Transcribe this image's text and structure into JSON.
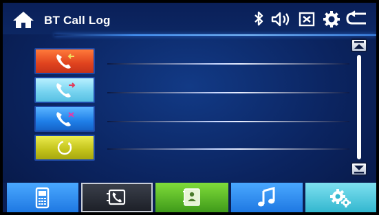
{
  "header": {
    "title": "BT Call Log"
  },
  "icons": {
    "home": "home-icon",
    "bluetooth": "bluetooth-icon",
    "volume": "volume-icon",
    "mute": "mute-x-icon",
    "settings": "gear-icon",
    "back": "back-icon"
  },
  "call_types": [
    {
      "name": "incoming-calls",
      "color": "#e0431e"
    },
    {
      "name": "outgoing-calls",
      "color": "#74d2ef"
    },
    {
      "name": "missed-calls",
      "color": "#1f7fe8"
    },
    {
      "name": "sync-calls",
      "color": "#c2c21a"
    }
  ],
  "call_log_entries": [],
  "tabs": [
    {
      "name": "phone",
      "color": "#1e78e2"
    },
    {
      "name": "call-log",
      "color": "#1d2028",
      "active": true
    },
    {
      "name": "contacts",
      "color": "#3f9a1a"
    },
    {
      "name": "music",
      "color": "#1e78e2"
    },
    {
      "name": "bt-settings",
      "color": "#33b7cf"
    }
  ],
  "colors": {
    "background": "#0b2460",
    "header_line": "#4a9bff",
    "text": "#ffffff"
  }
}
